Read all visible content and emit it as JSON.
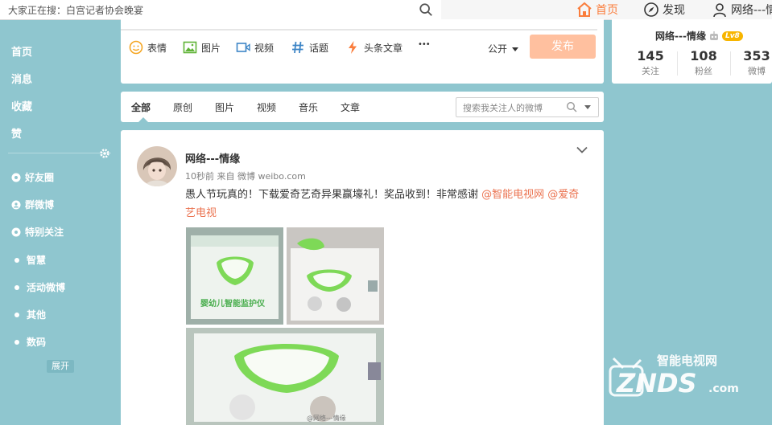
{
  "topbar": {
    "search_text": "大家正在搜：白宫记者协会晚宴",
    "nav_home": "首页",
    "nav_discover": "发现",
    "nav_user": "网络---情"
  },
  "sidebar": {
    "main": [
      "首页",
      "消息",
      "收藏",
      "赞"
    ],
    "groups": [
      {
        "label": "好友圈",
        "icon": "eye-icon"
      },
      {
        "label": "群微博",
        "icon": "people-icon"
      },
      {
        "label": "特别关注",
        "icon": "eye-icon"
      }
    ],
    "lists": [
      "智慧",
      "活动微博",
      "其他",
      "数码"
    ],
    "expand": "展开"
  },
  "composer": {
    "tools": [
      {
        "label": "表情",
        "icon": "smiley-icon"
      },
      {
        "label": "图片",
        "icon": "image-icon"
      },
      {
        "label": "视频",
        "icon": "video-icon"
      },
      {
        "label": "话题",
        "icon": "hashtag-icon"
      },
      {
        "label": "头条文章",
        "icon": "lightning-icon"
      }
    ],
    "more": "•••",
    "visibility": "公开",
    "publish": "发布"
  },
  "feed_tabs": {
    "tabs": [
      "全部",
      "原创",
      "图片",
      "视频",
      "音乐",
      "文章"
    ],
    "active": "全部",
    "search_placeholder": "搜索我关注人的微博"
  },
  "post": {
    "author": "网络---情缘",
    "meta": "10秒前 来自 微博 weibo.com",
    "text": "愚人节玩真的！下载爱奇艺奇异果赢壕礼！奖品收到！非常感谢 ",
    "mention1": "@智能电视网",
    "mention2": "@爱奇艺电视",
    "photo_label": "婴幼儿智能监护仪"
  },
  "profile": {
    "name": "网络---情缘",
    "level": "Lv8",
    "stats": [
      {
        "value": "145",
        "label": "关注"
      },
      {
        "value": "108",
        "label": "粉丝"
      },
      {
        "value": "353",
        "label": "微博"
      }
    ]
  },
  "watermark": {
    "top": "智能电视网",
    "brand": "ZNDS",
    "suffix": ".com"
  },
  "colors": {
    "accent": "#fa7d3c",
    "background": "#8fc6cf",
    "mention": "#eb7350",
    "publish_disabled": "#ffc09f"
  }
}
